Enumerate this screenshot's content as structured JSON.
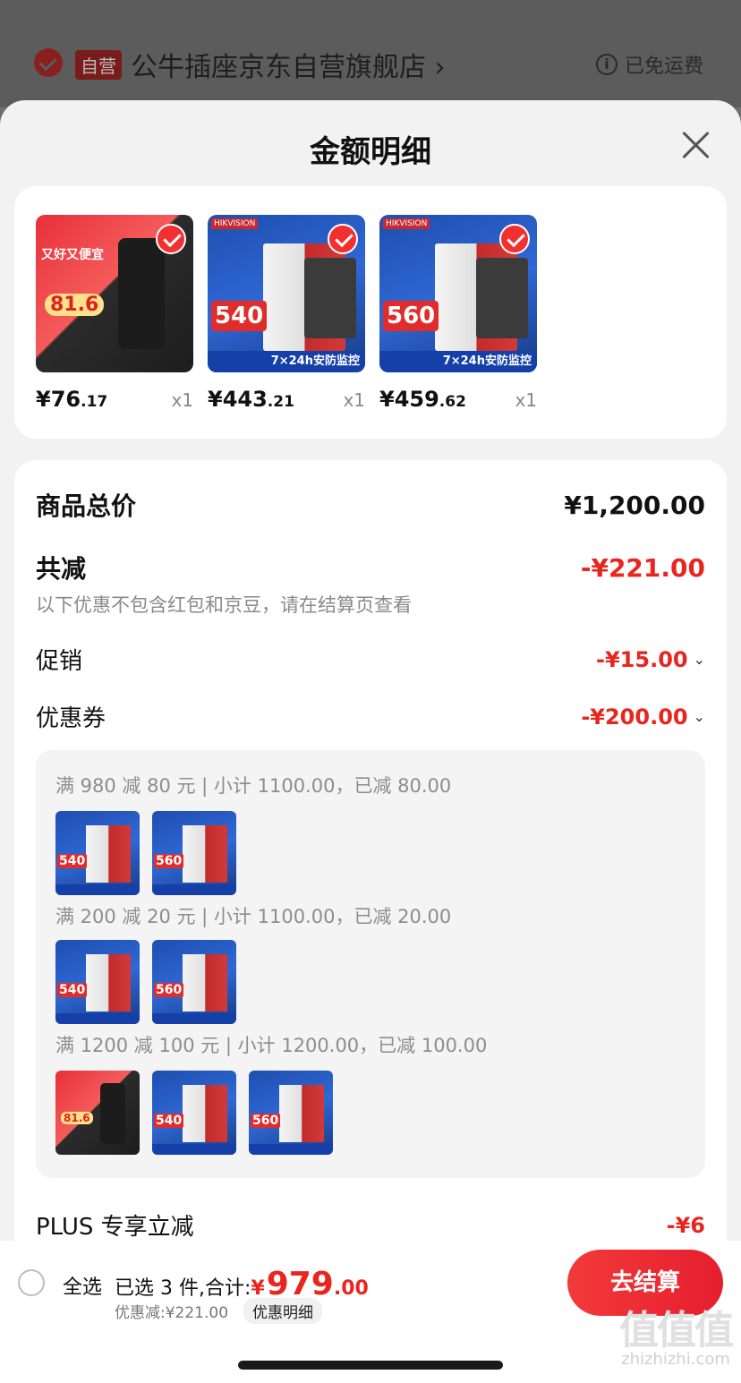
{
  "store": {
    "tag": "自营",
    "name": "公牛插座京东自营旗舰店 ›",
    "shipping": "已免运费",
    "info_icon": "i"
  },
  "sheet": {
    "title": "金额明细"
  },
  "products": [
    {
      "price_int": "¥76",
      "price_dec": ".17",
      "qty": "x1",
      "thumb": "power-strip",
      "overlay_price": "81.6",
      "overlay_label": "又好又便宜"
    },
    {
      "price_int": "¥443",
      "price_dec": ".21",
      "qty": "x1",
      "thumb": "hdd-540",
      "overlay_num": "540",
      "strip": "7×24h安防监控",
      "brand": "HIKVISION"
    },
    {
      "price_int": "¥459",
      "price_dec": ".62",
      "qty": "x1",
      "thumb": "hdd-560",
      "overlay_num": "560",
      "strip": "7×24h安防监控",
      "brand": "HIKVISION"
    }
  ],
  "summary": {
    "goods_total_label": "商品总价",
    "goods_total_value": "¥1,200.00",
    "reduce_label": "共减",
    "reduce_value": "-¥221.00",
    "reduce_note": "以下优惠不包含红包和京豆，请在结算页查看",
    "promo_label": "促销",
    "promo_value": "-¥15.00",
    "coupon_label": "优惠券",
    "coupon_value": "-¥200.00",
    "plus_label": "PLUS 专享立减",
    "plus_value": "-¥6"
  },
  "coupons": [
    {
      "text": "满 980 减 80 元 | 小计 1100.00，已减 80.00",
      "items": [
        {
          "type": "hdd",
          "num": "540"
        },
        {
          "type": "hdd",
          "num": "560"
        }
      ]
    },
    {
      "text": "满 200 减 20 元 | 小计 1100.00，已减 20.00",
      "items": [
        {
          "type": "hdd",
          "num": "540"
        },
        {
          "type": "hdd",
          "num": "560"
        }
      ]
    },
    {
      "text": "满 1200 减 100 元 | 小计 1200.00，已减 100.00",
      "items": [
        {
          "type": "strip",
          "num": "81.6"
        },
        {
          "type": "hdd",
          "num": "540"
        },
        {
          "type": "hdd",
          "num": "560"
        }
      ]
    }
  ],
  "bottom": {
    "select_all": "全选",
    "selected_prefix": "已选 3 件,合计:",
    "total_yen": "¥",
    "total_int": "979",
    "total_dec": ".00",
    "discount": "优惠减:¥221.00",
    "detail_link": "优惠明细",
    "checkout": "去结算"
  },
  "watermark": {
    "glyphs": "值值值",
    "url": "zhizhizhi.com"
  }
}
